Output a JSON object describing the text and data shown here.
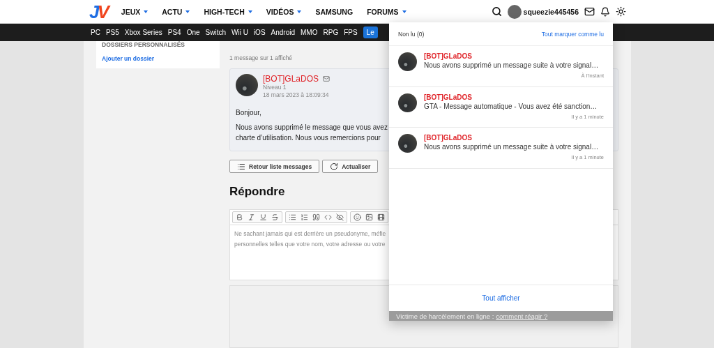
{
  "header": {
    "logo_letters": [
      "J",
      "V"
    ],
    "nav": [
      {
        "label": "JEUX",
        "caret": true
      },
      {
        "label": "ACTU",
        "caret": true
      },
      {
        "label": "HIGH-TECH",
        "caret": true
      },
      {
        "label": "VIDÉOS",
        "caret": true
      },
      {
        "label": "SAMSUNG",
        "caret": false
      },
      {
        "label": "FORUMS",
        "caret": true
      }
    ],
    "username": "squeezie445456"
  },
  "subnav": {
    "items": [
      "PC",
      "PS5",
      "Xbox Series",
      "PS4",
      "One",
      "Switch",
      "Wii U",
      "iOS",
      "Android",
      "MMO",
      "RPG",
      "FPS"
    ],
    "highlight": "Le"
  },
  "sidebar": {
    "heading": "DOSSIERS PERSONNALISÉS",
    "link": "Ajouter un dossier"
  },
  "messages": {
    "count": "1 message sur 1 affiché",
    "message": {
      "author": "[BOT]GLaDOS",
      "level": "Niveau 1",
      "date": "18 mars 2023 à 18:09:34",
      "greeting": "Bonjour,",
      "lines": [
        "Nous avons supprimé le message que vous avez",
        "charte d’utilisation. Nous vous remercions pour"
      ]
    },
    "buttons": [
      {
        "kind": "list",
        "label": "Retour liste messages"
      },
      {
        "kind": "refresh",
        "label": "Actualiser"
      }
    ]
  },
  "reply": {
    "title": "Répondre",
    "placeholder": "Ne sachant jamais qui est derrière un pseudonyme, méfie\npersonnelles telles que votre nom, votre adresse ou votre"
  },
  "notifications": {
    "header": "Non lu (0)",
    "mark_all": "Tout marquer comme lu",
    "items": [
      {
        "author": "[BOT]GLaDOS",
        "text": "Nous avons supprimé un message suite à votre signal…",
        "time": "À l’instant"
      },
      {
        "author": "[BOT]GLaDOS",
        "text": "GTA - Message automatique - Vous avez été sanction…",
        "time": "Il y a 1 minute"
      },
      {
        "author": "[BOT]GLaDOS",
        "text": "Nous avons supprimé un message suite à votre signal…",
        "time": "Il y a 1 minute"
      }
    ],
    "show_all": "Tout afficher"
  },
  "banner": {
    "text": "Victime de harcèlement en ligne :",
    "link": "comment réagir ?"
  }
}
